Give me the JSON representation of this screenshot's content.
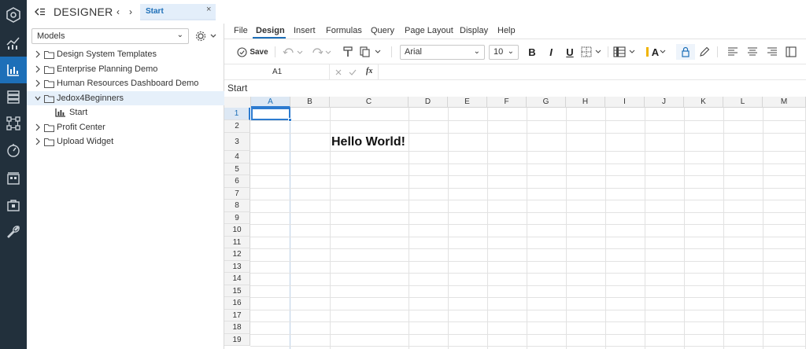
{
  "header": {
    "app_title": "DESIGNER",
    "tab_label": "Start",
    "tab_close": "×"
  },
  "sidebar": {
    "models_select_value": "Models",
    "items": [
      {
        "label": "Design System Templates"
      },
      {
        "label": "Enterprise Planning Demo"
      },
      {
        "label": "Human Resources Dashboard Demo"
      },
      {
        "label": "Jedox4Beginners"
      },
      {
        "label": "Start"
      },
      {
        "label": "Profit Center"
      },
      {
        "label": "Upload Widget"
      }
    ]
  },
  "menu": {
    "items": [
      "File",
      "Design",
      "Insert",
      "Formulas",
      "Query",
      "Page Layout",
      "Display",
      "Help"
    ],
    "active": "Design"
  },
  "toolbar": {
    "save_label": "Save",
    "font_family": "Arial",
    "font_size": "10",
    "bold": "B",
    "italic": "I",
    "underline": "U",
    "font_color_label": "A",
    "accent": "#1d6fb8"
  },
  "formula_bar": {
    "cell_ref": "A1",
    "fx_label": "fx",
    "value": ""
  },
  "sheet": {
    "title": "Start",
    "columns": [
      "A",
      "B",
      "C",
      "D",
      "E",
      "F",
      "G",
      "H",
      "I",
      "J",
      "K",
      "L",
      "M"
    ],
    "rows": [
      "1",
      "2",
      "3",
      "4",
      "5",
      "6",
      "7",
      "8",
      "9",
      "10",
      "11",
      "12",
      "13",
      "14",
      "15",
      "16",
      "17",
      "18",
      "19"
    ],
    "cells": [
      {
        "ref": "C3",
        "value": "Hello World!"
      }
    ]
  }
}
